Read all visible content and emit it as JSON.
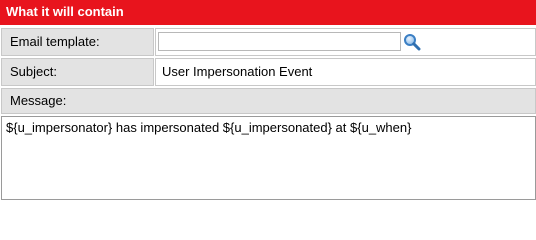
{
  "section": {
    "title": "What it will contain"
  },
  "fields": {
    "email_template": {
      "label": "Email template:",
      "value": "",
      "placeholder": ""
    },
    "subject": {
      "label": "Subject:",
      "value": "User Impersonation Event"
    },
    "message": {
      "label": "Message:",
      "value": "${u_impersonator} has impersonated ${u_impersonated} at ${u_when}"
    }
  },
  "icons": {
    "template_lookup": "magnifier-icon"
  },
  "colors": {
    "header_bg": "#e8141d",
    "label_bg": "#e3e3e3",
    "border": "#c8c8c8",
    "icon": "#3b7fc4"
  }
}
